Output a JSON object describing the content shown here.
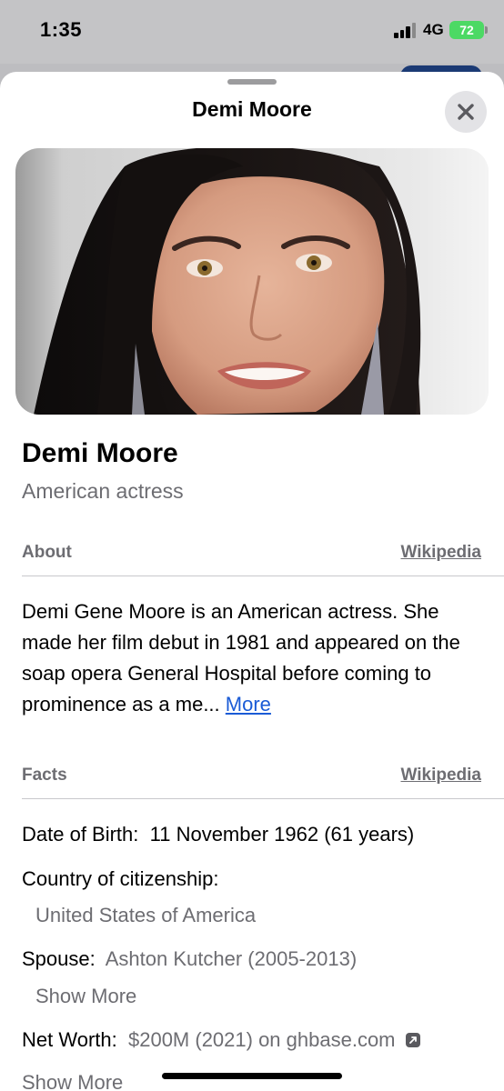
{
  "status_bar": {
    "time": "1:35",
    "network": "4G",
    "battery": "72"
  },
  "sheet": {
    "title": "Demi Moore",
    "close_icon": "close-icon"
  },
  "entity": {
    "name": "Demi Moore",
    "description": "American actress"
  },
  "about": {
    "label": "About",
    "source": "Wikipedia",
    "text": "Demi Gene Moore is an American actress. She made her film debut in 1981 and appeared on the soap opera General Hospital before coming to prominence as a me...",
    "more": "More"
  },
  "facts": {
    "label": "Facts",
    "source": "Wikipedia",
    "birth_label": "Date of Birth:",
    "birth_value": "11 November 1962 (61 years)",
    "citizenship_label": "Country of citizenship:",
    "citizenship_value": "United States of America",
    "spouse_label": "Spouse:",
    "spouse_value": "Ashton Kutcher (2005-2013)",
    "spouse_more": "Show More",
    "net_worth_label": "Net Worth:",
    "net_worth_value": "$200M (2021) on ghbase.com",
    "net_worth_more": "Show More"
  },
  "colors": {
    "link_blue": "#1a5bd6",
    "secondary_gray": "#6d6d72",
    "battery_green": "#4cd964"
  }
}
